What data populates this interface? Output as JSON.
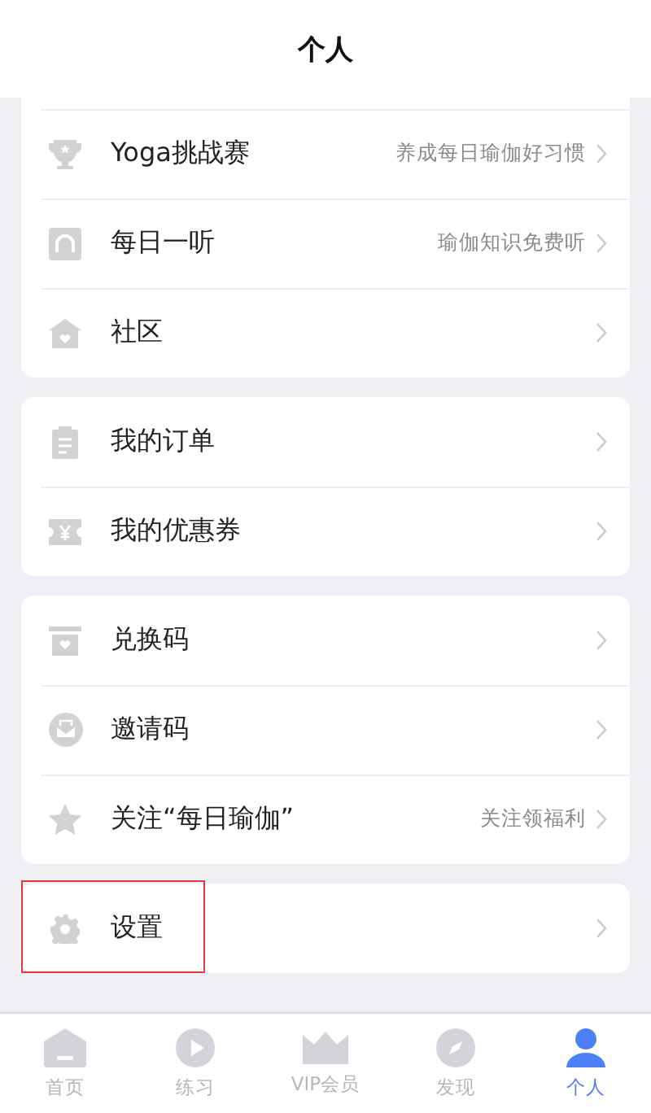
{
  "header": {
    "title": "个人"
  },
  "groups": [
    {
      "items": [
        {
          "label": "Yoga挑战赛",
          "hint": "养成每日瑜伽好习惯",
          "highlighted": false
        },
        {
          "label": "每日一听",
          "hint": "瑜伽知识免费听",
          "highlighted": false
        },
        {
          "label": "社区",
          "highlighted": false
        }
      ]
    },
    {
      "items": [
        {
          "label": "我的订单",
          "highlighted": false
        },
        {
          "label": "我的优惠券",
          "highlighted": false
        }
      ]
    },
    {
      "items": [
        {
          "label": "兑换码",
          "highlighted": false
        },
        {
          "label": "邀请码",
          "highlighted": false
        },
        {
          "label": "关注“每日瑜伽”",
          "hint": "关注领福利",
          "highlighted": false
        }
      ]
    },
    {
      "items": [
        {
          "label": "设置",
          "highlighted": true
        }
      ]
    }
  ],
  "tab_bar": [
    {
      "label": "首页",
      "selected": false
    },
    {
      "label": "练习",
      "selected": false
    },
    {
      "label": "VIP会员",
      "selected": false
    },
    {
      "label": "发现",
      "selected": false
    },
    {
      "label": "个人",
      "selected": true
    }
  ]
}
